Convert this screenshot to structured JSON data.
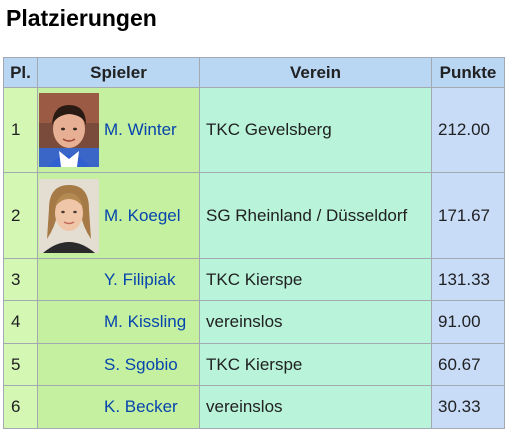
{
  "title": "Platzierungen",
  "table": {
    "headers": {
      "pl": "Pl.",
      "spieler": "Spieler",
      "verein": "Verein",
      "punkte": "Punkte"
    },
    "rows": [
      {
        "pl": "1",
        "spieler": "M. Winter",
        "verein": "TKC Gevelsberg",
        "punkte": "212.00",
        "photo": "player-photo-winter"
      },
      {
        "pl": "2",
        "spieler": "M. Koegel",
        "verein": "SG Rheinland / Düsseldorf",
        "punkte": "171.67",
        "photo": "player-photo-koegel"
      },
      {
        "pl": "3",
        "spieler": "Y. Filipiak",
        "verein": "TKC Kierspe",
        "punkte": "131.33"
      },
      {
        "pl": "4",
        "spieler": "M. Kissling",
        "verein": "vereinslos",
        "punkte": "91.00"
      },
      {
        "pl": "5",
        "spieler": "S. Sgobio",
        "verein": "TKC Kierspe",
        "punkte": "60.67"
      },
      {
        "pl": "6",
        "spieler": "K. Becker",
        "verein": "vereinslos",
        "punkte": "30.33"
      }
    ]
  },
  "colors": {
    "header_bg": "#b9d6f3",
    "pl_bg": "#d5f7b4",
    "spieler_bg": "#c5f0a0",
    "verein_bg": "#b9f3d9",
    "punkte_bg": "#c8dcf7",
    "link": "#0645ad",
    "border": "#a2a9b1"
  }
}
